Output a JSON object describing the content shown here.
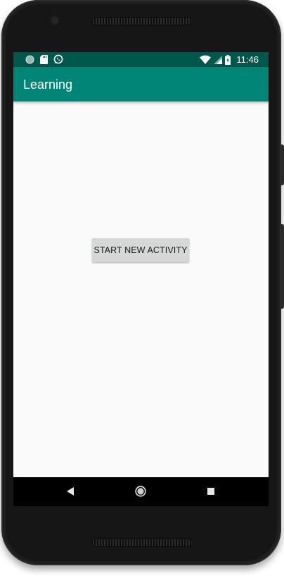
{
  "status_bar": {
    "time": "11:46",
    "left_icons": [
      "notification-dot-icon",
      "sd-card-icon",
      "whatsapp-icon"
    ],
    "right_icons": [
      "wifi-icon",
      "cell-signal-icon",
      "battery-icon"
    ]
  },
  "app_bar": {
    "title": "Learning"
  },
  "main": {
    "button_label": "START NEW ACTIVITY"
  },
  "nav_bar": {
    "icons": [
      "back-icon",
      "home-icon",
      "recents-icon"
    ]
  },
  "colors": {
    "status_bar": "#00574b",
    "app_bar": "#008577",
    "background": "#fafafa",
    "button": "#d6d7d7",
    "nav_bar": "#000000",
    "phone_frame": "#1f1f1f"
  }
}
